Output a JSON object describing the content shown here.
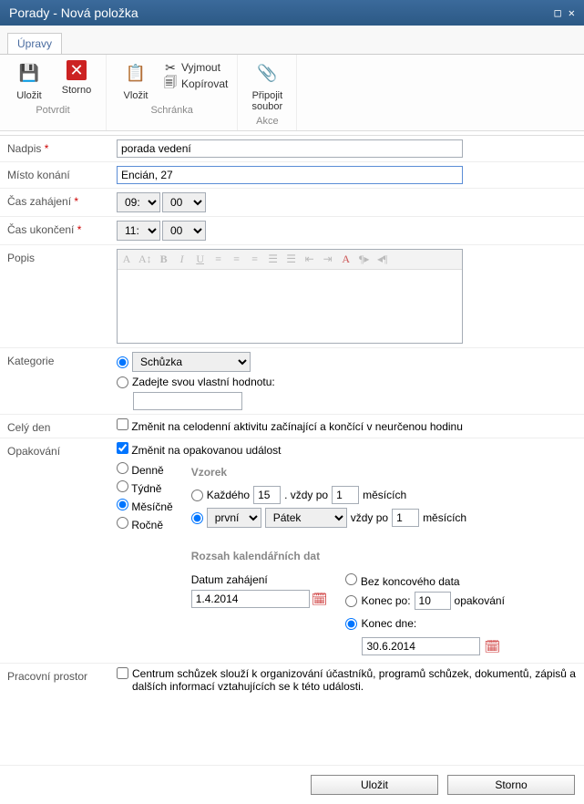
{
  "titlebar": {
    "title": "Porady - Nová položka"
  },
  "tabs": {
    "edit": "Úpravy"
  },
  "ribbon": {
    "save": "Uložit",
    "cancel": "Storno",
    "confirm_group": "Potvrdit",
    "paste": "Vložit",
    "cut": "Vyjmout",
    "copy": "Kopírovat",
    "clipboard_group": "Schránka",
    "attach": "Připojit soubor",
    "actions_group": "Akce"
  },
  "form": {
    "title_lbl": "Nadpis",
    "title_val": "porada vedení",
    "location_lbl": "Místo konání",
    "location_val": "Encián, 27",
    "start_lbl": "Čas zahájení",
    "start_h": "09:",
    "start_m": "00",
    "end_lbl": "Čas ukončení",
    "end_h": "11:",
    "end_m": "00",
    "desc_lbl": "Popis",
    "cat_lbl": "Kategorie",
    "cat_val": "Schůzka",
    "cat_custom": "Zadejte svou vlastní hodnotu:",
    "allday_lbl": "Celý den",
    "allday_chk": "Změnit na celodenní aktivitu začínající a končící v neurčenou hodinu",
    "recur_lbl": "Opakování",
    "recur_chk": "Změnit na opakovanou událost",
    "daily": "Denně",
    "weekly": "Týdně",
    "monthly": "Měsíčně",
    "yearly": "Ročně",
    "pattern_hdr": "Vzorek",
    "each": "Každého",
    "day_val": "15",
    "every_after": ". vždy po",
    "mon_val1": "1",
    "months": "měsících",
    "ord_val": "první",
    "dow_val": "Pátek",
    "every_after2": "vždy po",
    "mon_val2": "1",
    "months2": "měsících",
    "range_hdr": "Rozsah kalendářních dat",
    "start_date_lbl": "Datum zahájení",
    "start_date": "1.4.2014",
    "no_end": "Bez koncového data",
    "end_after": "Konec po:",
    "occ_val": "10",
    "occ_lbl": "opakování",
    "end_by": "Konec dne:",
    "end_date": "30.6.2014",
    "work_lbl": "Pracovní prostor",
    "work_chk": "Centrum schůzek slouží k organizování účastníků, programů schůzek, dokumentů, zápisů a dalších informací vztahujících se k této události."
  },
  "buttons": {
    "save": "Uložit",
    "cancel": "Storno"
  }
}
